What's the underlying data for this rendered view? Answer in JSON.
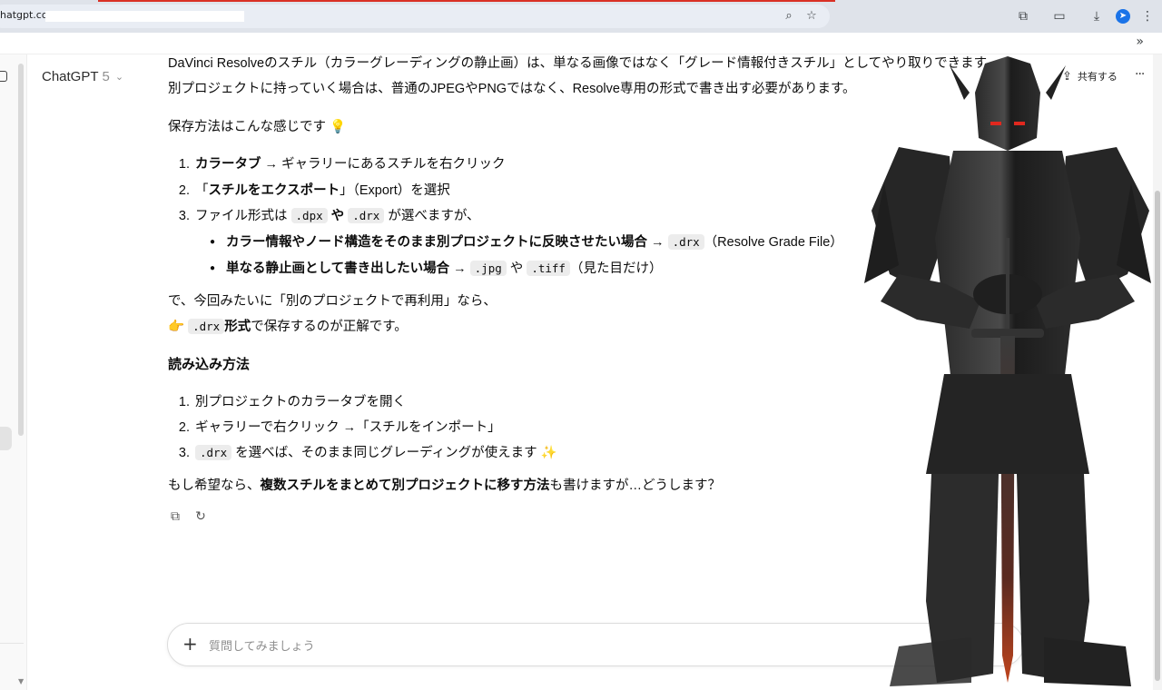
{
  "browser": {
    "url": "hatgpt.com/",
    "icons": [
      "zoom-icon",
      "star-icon",
      "extensions-icon",
      "media-icon",
      "download-icon",
      "profile-icon",
      "menu-icon",
      "bookmarks-chevron-icon"
    ]
  },
  "header": {
    "model_name": "ChatGPT",
    "model_version": "5",
    "share_label": "共有する",
    "more_label": "···"
  },
  "message": {
    "intro_1": "DaVinci Resolveのスチル（カラーグレーディングの静止画）は、単なる画像ではなく「グレード情報付きスチル」としてやり取りできます。",
    "intro_2": "別プロジェクトに持っていく場合は、普通のJPEGやPNGではなく、Resolve専用の形式で書き出す必要があります。",
    "save_heading": "保存方法はこんな感じです",
    "save_heading_emoji": "💡",
    "save_steps": [
      {
        "num": "1.",
        "bold": "カラータブ",
        "rest": " → ギャラリーにあるスチルを右クリック"
      },
      {
        "num": "2.",
        "pre": "「",
        "bold": "スチルをエクスポート",
        "rest": "」（Export）を選択"
      },
      {
        "num": "3.",
        "pre": "ファイル形式は ",
        "code1": ".dpx",
        "mid": " や ",
        "code2": ".drx",
        "rest": " が選べますが、"
      }
    ],
    "bullets": [
      {
        "bold": "カラー情報やノード構造をそのまま別プロジェクトに反映させたい場合",
        "arrow": " → ",
        "code": ".drx",
        "rest": "（Resolve Grade File）"
      },
      {
        "bold": "単なる静止画として書き出したい場合",
        "arrow": " → ",
        "code": ".jpg",
        "mid": " や ",
        "code2": ".tiff",
        "rest": "（見た目だけ）"
      }
    ],
    "conclusion_1": "で、今回みたいに「別のプロジェクトで再利用」なら、",
    "conclusion_emoji": "👉",
    "conclusion_code": ".drx",
    "conclusion_bold": "形式",
    "conclusion_rest": "で保存するのが正解です。",
    "load_heading": "読み込み方法",
    "load_steps": [
      {
        "num": "1.",
        "text": "別プロジェクトのカラータブを開く"
      },
      {
        "num": "2.",
        "text": "ギャラリーで右クリック →「スチルをインポート」"
      },
      {
        "num": "3.",
        "code": ".drx",
        "text": " を選べば、そのまま同じグレーディングが使えます",
        "emoji": "✨"
      }
    ],
    "closing_pre": "もし希望なら、",
    "closing_bold": "複数スチルをまとめて別プロジェクトに移す方法",
    "closing_rest": "も書けますが…どうします？"
  },
  "composer": {
    "plus": "+",
    "placeholder": "質問してみましょう"
  },
  "colors": {
    "chrome_bg": "#dfe3ea",
    "omnibox_bg": "#e9edf4",
    "accent_red": "#d93025",
    "code_bg": "#ececec",
    "text": "#0d0d0d"
  }
}
